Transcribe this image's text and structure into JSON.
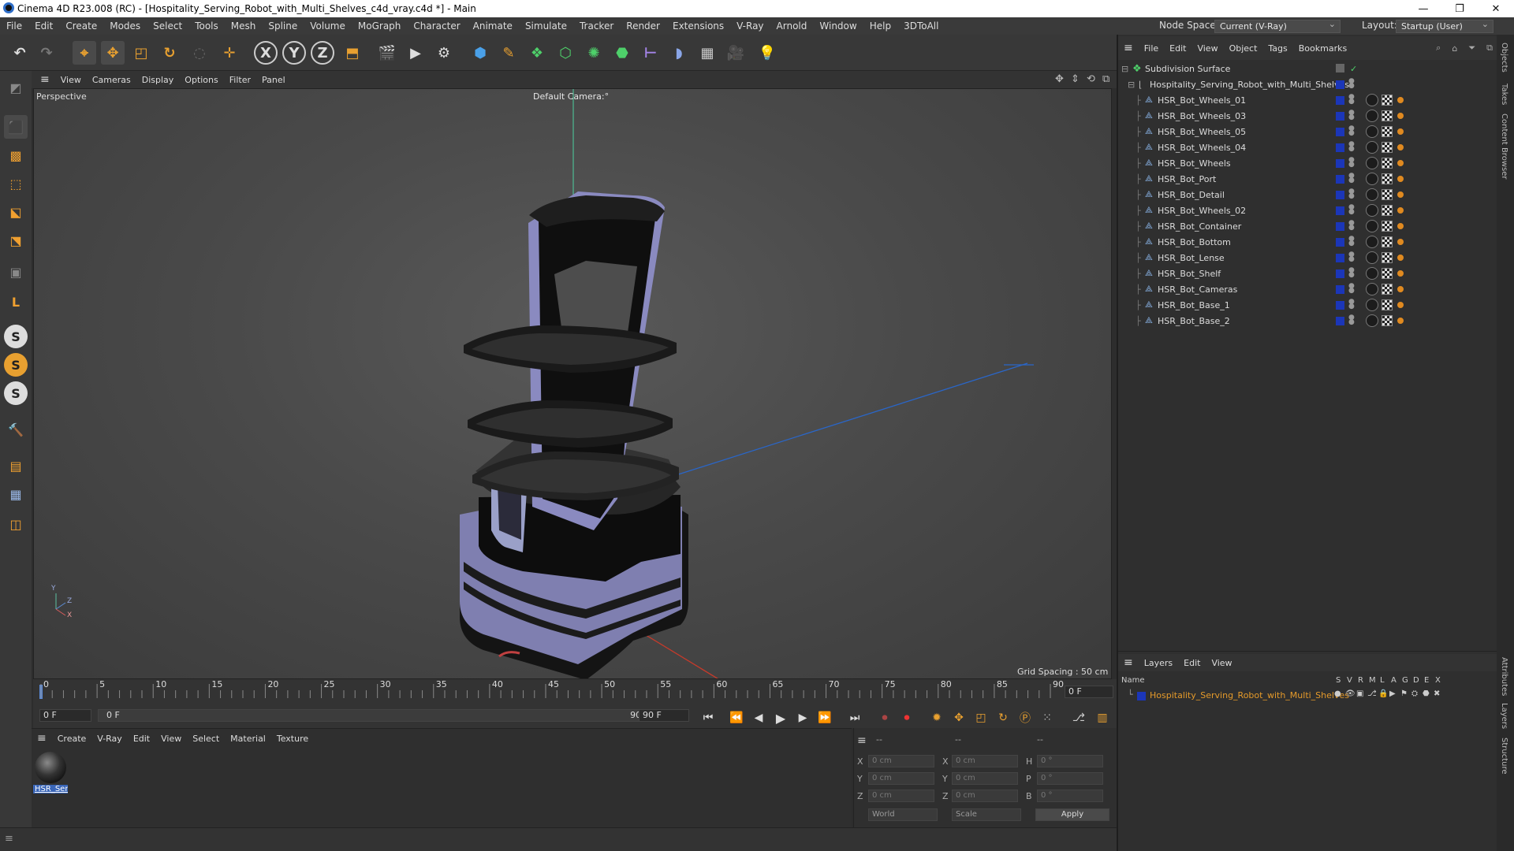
{
  "window": {
    "title": "Cinema 4D R23.008 (RC) - [Hospitality_Serving_Robot_with_Multi_Shelves_c4d_vray.c4d *] - Main",
    "minimize": "—",
    "maximize": "❐",
    "close": "✕"
  },
  "menubar": {
    "items": [
      "File",
      "Edit",
      "Create",
      "Modes",
      "Select",
      "Tools",
      "Mesh",
      "Spline",
      "Volume",
      "MoGraph",
      "Character",
      "Animate",
      "Simulate",
      "Tracker",
      "Render",
      "Extensions",
      "V-Ray",
      "Arnold",
      "Window",
      "Help",
      "3DToAll"
    ],
    "node_space_label": "Node Space:",
    "node_space_value": "Current (V-Ray)",
    "layout_label": "Layout:",
    "layout_value": "Startup (User)"
  },
  "toolbar": {
    "axis_x": "X",
    "axis_y": "Y",
    "axis_z": "Z"
  },
  "left_tools": {
    "snap_s1": "S",
    "snap_s2": "S",
    "snap_s3": "S",
    "l_tool": "L"
  },
  "viewport_menu": {
    "items": [
      "View",
      "Cameras",
      "Display",
      "Options",
      "Filter",
      "Panel"
    ]
  },
  "viewport": {
    "label": "Perspective",
    "camera": "Default Camera",
    "camera_suffix": ":°",
    "grid_spacing": "Grid Spacing : 50 cm",
    "axis_y": "Y",
    "axis_z": "Z",
    "axis_x": "X"
  },
  "timeline": {
    "ticks": [
      "0",
      "5",
      "10",
      "15",
      "20",
      "25",
      "30",
      "35",
      "40",
      "45",
      "50",
      "55",
      "60",
      "65",
      "70",
      "75",
      "80",
      "85",
      "90"
    ],
    "current_frame": "0 F"
  },
  "transport": {
    "start_frame": "0 F",
    "range_start": "0 F",
    "range_end": "90 F",
    "end_frame": "90 F"
  },
  "material_manager": {
    "menu": [
      "Create",
      "V-Ray",
      "Edit",
      "View",
      "Select",
      "Material",
      "Texture"
    ],
    "materials": [
      {
        "name": "HSR_Ser"
      }
    ]
  },
  "attributes": {
    "headers": [
      "--",
      "--",
      "--"
    ],
    "rows": [
      {
        "a": "X",
        "av": "0 cm",
        "b": "X",
        "bv": "0 cm",
        "c": "H",
        "cv": "0 °"
      },
      {
        "a": "Y",
        "av": "0 cm",
        "b": "Y",
        "bv": "0 cm",
        "c": "P",
        "cv": "0 °"
      },
      {
        "a": "Z",
        "av": "0 cm",
        "b": "Z",
        "bv": "0 cm",
        "c": "B",
        "cv": "0 °"
      }
    ],
    "coord_system": "World",
    "mode": "Scale",
    "apply": "Apply"
  },
  "object_manager": {
    "menu": [
      "File",
      "Edit",
      "View",
      "Object",
      "Tags",
      "Bookmarks"
    ],
    "root": "Subdivision Surface",
    "group": "Hospitality_Serving_Robot_with_Multi_Shelves",
    "children": [
      "HSR_Bot_Wheels_01",
      "HSR_Bot_Wheels_03",
      "HSR_Bot_Wheels_05",
      "HSR_Bot_Wheels_04",
      "HSR_Bot_Wheels",
      "HSR_Bot_Port",
      "HSR_Bot_Detail",
      "HSR_Bot_Wheels_02",
      "HSR_Bot_Container",
      "HSR_Bot_Bottom",
      "HSR_Bot_Lense",
      "HSR_Bot_Shelf",
      "HSR_Bot_Cameras",
      "HSR_Bot_Base_1",
      "HSR_Bot_Base_2"
    ]
  },
  "layers": {
    "menu": [
      "Layers",
      "Edit",
      "View"
    ],
    "name_header": "Name",
    "columns": [
      "S",
      "V",
      "R",
      "M",
      "L",
      "A",
      "G",
      "D",
      "E",
      "X"
    ],
    "items": [
      {
        "name": "Hospitality_Serving_Robot_with_Multi_Shelves",
        "color": "#1b36b8"
      }
    ]
  },
  "side_tabs": [
    "Objects",
    "Takes",
    "Content Browser",
    "Attributes",
    "Layers",
    "Structure"
  ],
  "colors": {
    "accent_orange": "#e08a20",
    "layer_text": "#e59a2a",
    "object_blue": "#1b36b8",
    "robot_body": "#7f7fb0"
  }
}
